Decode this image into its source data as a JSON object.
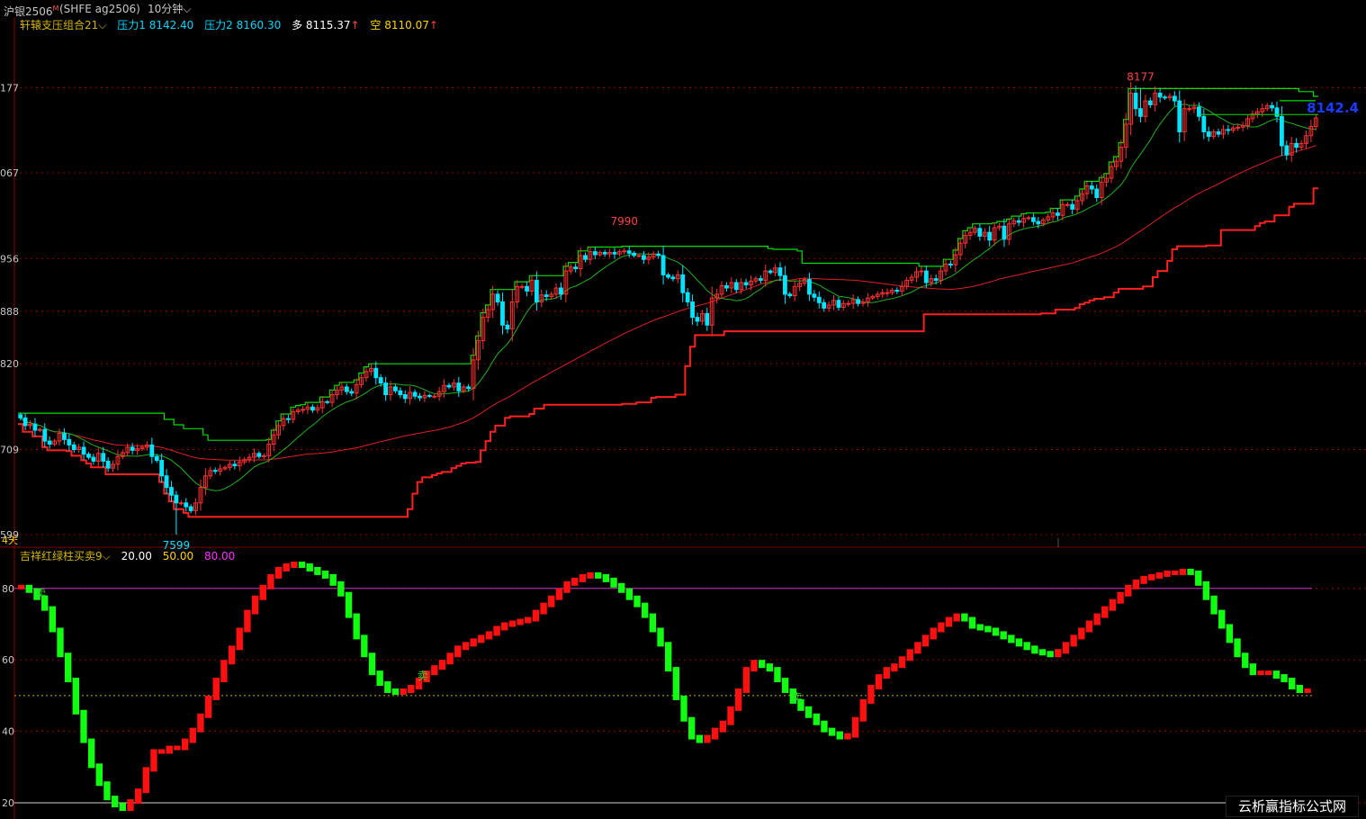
{
  "header": {
    "symbol": "沪银2506",
    "symbol_mark": "M",
    "exchange": "(SHFE  ag2506)",
    "period": "10分钟"
  },
  "main_indicator": {
    "name": "轩辕支压组合21",
    "p1_label": "压力1",
    "p1_value": "8142.40",
    "p2_label": "压力2",
    "p2_value": "8160.30",
    "long_label": "多",
    "long_value": "8115.37",
    "short_label": "空",
    "short_value": "8110.07"
  },
  "sub_indicator": {
    "name": "吉祥红绿柱买卖9",
    "v1": "20.00",
    "v2": "50.00",
    "v3": "80.00"
  },
  "period_label": "4天",
  "watermark": "云析赢指标公式网",
  "chart_data": [
    {
      "type": "candlestick",
      "ylim": [
        7599,
        8230
      ],
      "y_ticks": [
        {
          "label": "177",
          "value": 8177
        },
        {
          "label": "067",
          "value": 8067
        },
        {
          "label": "956",
          "value": 7956
        },
        {
          "label": "888",
          "value": 7888
        },
        {
          "label": "820",
          "value": 7820
        },
        {
          "label": "709",
          "value": 7709
        },
        {
          "label": "599",
          "value": 7599
        }
      ],
      "annotations": [
        {
          "text": "8177",
          "value": 8177,
          "color": "#ff4040"
        },
        {
          "text": "7990",
          "value": 7990,
          "color": "#ff4040"
        },
        {
          "text": "7599",
          "value": 7599,
          "color": "#00e5ff"
        },
        {
          "text": "8142.4",
          "value": 8142.4,
          "color": "#1a3cff"
        }
      ],
      "bull_color": "#ff3030",
      "bear_color": "#00e5ff",
      "close": [
        7750,
        7740,
        7742,
        7734,
        7735,
        7720,
        7716,
        7720,
        7730,
        7722,
        7715,
        7709,
        7712,
        7703,
        7699,
        7694,
        7704,
        7694,
        7685,
        7690,
        7700,
        7705,
        7712,
        7708,
        7710,
        7712,
        7715,
        7700,
        7695,
        7675,
        7660,
        7650,
        7640,
        7640,
        7635,
        7630,
        7640,
        7660,
        7675,
        7682,
        7681,
        7684,
        7686,
        7690,
        7688,
        7693,
        7696,
        7699,
        7704,
        7700,
        7701,
        7716,
        7728,
        7740,
        7749,
        7748,
        7758,
        7760,
        7761,
        7764,
        7760,
        7763,
        7771,
        7770,
        7780,
        7786,
        7790,
        7784,
        7782,
        7793,
        7802,
        7810,
        7814,
        7802,
        7795,
        7780,
        7790,
        7785,
        7780,
        7775,
        7783,
        7778,
        7776,
        7779,
        7778,
        7778,
        7784,
        7792,
        7790,
        7795,
        7785,
        7790,
        7788,
        7825,
        7850,
        7880,
        7890,
        7910,
        7900,
        7870,
        7865,
        7900,
        7920,
        7920,
        7914,
        7928,
        7900,
        7909,
        7907,
        7910,
        7918,
        7910,
        7940,
        7945,
        7943,
        7960,
        7955,
        7965,
        7961,
        7964,
        7962,
        7964,
        7962,
        7965,
        7966,
        7963,
        7960,
        7960,
        7955,
        7958,
        7962,
        7960,
        7935,
        7932,
        7930,
        7935,
        7912,
        7900,
        7880,
        7875,
        7885,
        7870,
        7905,
        7910,
        7921,
        7918,
        7925,
        7916,
        7925,
        7922,
        7927,
        7930,
        7928,
        7940,
        7938,
        7944,
        7934,
        7910,
        7908,
        7920,
        7924,
        7929,
        7910,
        7906,
        7899,
        7892,
        7896,
        7902,
        7893,
        7898,
        7898,
        7903,
        7898,
        7900,
        7905,
        7907,
        7910,
        7912,
        7912,
        7915,
        7914,
        7920,
        7928,
        7932,
        7939,
        7940,
        7925,
        7930,
        7928,
        7940,
        7949,
        7948,
        7961,
        7976,
        7986,
        7990,
        7995,
        7985,
        7990,
        7980,
        7996,
        7998,
        7981,
        8001,
        8005,
        8003,
        8008,
        8009,
        8004,
        8001,
        8006,
        8010,
        8015,
        8012,
        8026,
        8026,
        8020,
        8031,
        8040,
        8050,
        8046,
        8035,
        8055,
        8060,
        8075,
        8082,
        8100,
        8130,
        8170,
        8150,
        8140,
        8160,
        8155,
        8170,
        8165,
        8164,
        8166,
        8160,
        8120,
        8150,
        8150,
        8152,
        8140,
        8120,
        8114,
        8120,
        8117,
        8123,
        8122,
        8125,
        8126,
        8128,
        8137,
        8143,
        8146,
        8150,
        8154,
        8151,
        8140,
        8102,
        8090,
        8105,
        8100,
        8105,
        8115,
        8127,
        8138
      ],
      "range": {
        "high": 8177,
        "low": 7599
      }
    },
    {
      "type": "bar",
      "ylim": [
        18,
        88
      ],
      "y_ticks": [
        {
          "label": "80",
          "value": 80
        },
        {
          "label": "60",
          "value": 60
        },
        {
          "label": "40",
          "value": 40
        },
        {
          "label": "20",
          "value": 20
        }
      ],
      "reference_lines": [
        {
          "value": 80,
          "color": "#cc33cc"
        },
        {
          "value": 50,
          "color": "#c8b400"
        },
        {
          "value": 20,
          "color": "#d0d0d0"
        }
      ],
      "signals": [
        {
          "text": "卖",
          "index": 2
        },
        {
          "text": "卖",
          "index": 51
        },
        {
          "text": "卖",
          "index": 99
        },
        {
          "text": "卖",
          "index": 186
        }
      ],
      "up_color": "#ff1010",
      "down_color": "#10ff10",
      "values": [
        81,
        80,
        78,
        75,
        69,
        62,
        55,
        46,
        38,
        31,
        26,
        22,
        20,
        19,
        21,
        24,
        30,
        35,
        35,
        36,
        36,
        38,
        41,
        45,
        50,
        55,
        60,
        64,
        69,
        74,
        78,
        81,
        84,
        86,
        87,
        87.5,
        87,
        86,
        85,
        84,
        82,
        79,
        73,
        67,
        62,
        57,
        54,
        52,
        51.5,
        52,
        53,
        55,
        57,
        58.5,
        60,
        62,
        64,
        65,
        66,
        67,
        68,
        69.5,
        70.5,
        71,
        71.5,
        72,
        74,
        76,
        78,
        80,
        82,
        83,
        84,
        84.5,
        84,
        83,
        81.5,
        80,
        78,
        76,
        73,
        69,
        65,
        58,
        50,
        44,
        39,
        38,
        39,
        41,
        43,
        47,
        52,
        58,
        60,
        59,
        58,
        55,
        52,
        49,
        47,
        45,
        43,
        41,
        40,
        39,
        39.5,
        44,
        49,
        53,
        56,
        58,
        59,
        61,
        63,
        65,
        67,
        69,
        70.5,
        72,
        73,
        72,
        70,
        69.5,
        69,
        68,
        67,
        66,
        65,
        64,
        63,
        62.5,
        62,
        63,
        65,
        67,
        69,
        71,
        73,
        75,
        77,
        79,
        81,
        82.5,
        83.5,
        84,
        84.5,
        85,
        85,
        85.5,
        85,
        82,
        78,
        74,
        70,
        66,
        62,
        59,
        57,
        57,
        57,
        56,
        55,
        53,
        52,
        52
      ]
    }
  ]
}
